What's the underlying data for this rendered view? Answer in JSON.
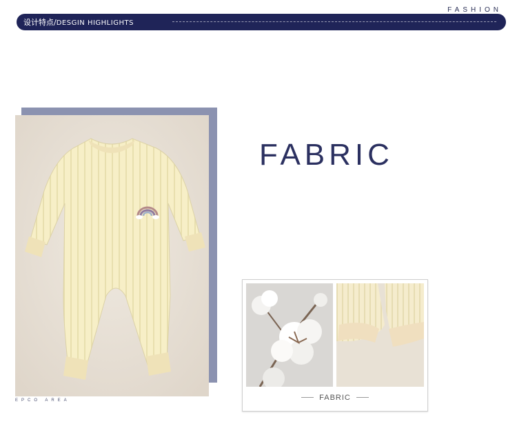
{
  "brand_tag": "FASHION",
  "header": {
    "title_cn": "设计特点/",
    "title_en": "DESGIN HIGHLIGHTS"
  },
  "area_tag": "EPCO AREA",
  "heading": "FABRIC",
  "detail_caption": "FABRIC",
  "colors": {
    "navy": "#1f2458",
    "garment": "#f7efc7",
    "frame_shadow": "#8b92b0"
  },
  "images": {
    "main": "baby-romper-photo",
    "detail_left": "cotton-bolls-photo",
    "detail_right": "ribbed-cuff-photo"
  }
}
